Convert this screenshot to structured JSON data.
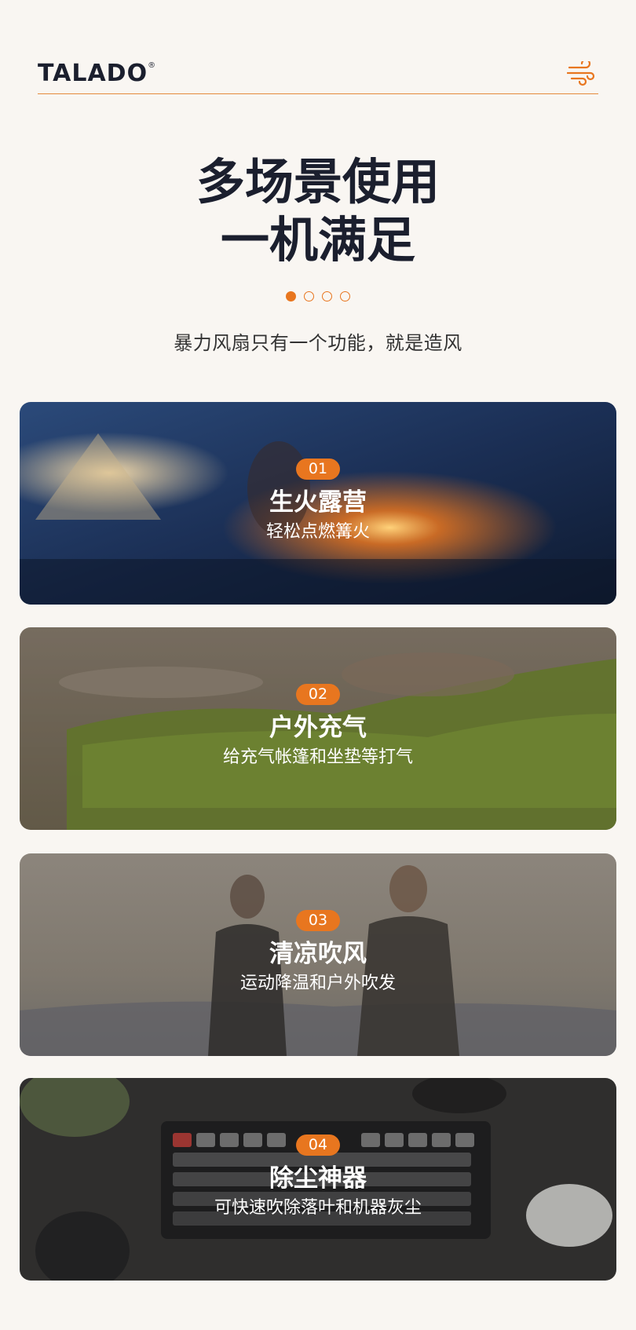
{
  "header": {
    "brand": "TALADO",
    "registered_mark": "®",
    "menu_icon": "wind-icon"
  },
  "hero": {
    "headline_line1": "多场景使用",
    "headline_line2": "一机满足",
    "subtitle": "暴力风扇只有一个功能，就是造风"
  },
  "pagination": {
    "total": 4,
    "active_index": 0
  },
  "colors": {
    "accent": "#e8761f",
    "text_dark": "#1b1f2e",
    "background": "#f9f6f2"
  },
  "cards": [
    {
      "number": "01",
      "title": "生火露营",
      "description": "轻松点燃篝火"
    },
    {
      "number": "02",
      "title": "户外充气",
      "description": "给充气帐篷和坐垫等打气"
    },
    {
      "number": "03",
      "title": "清凉吹风",
      "description": "运动降温和户外吹发"
    },
    {
      "number": "04",
      "title": "除尘神器",
      "description": "可快速吹除落叶和机器灰尘"
    }
  ]
}
